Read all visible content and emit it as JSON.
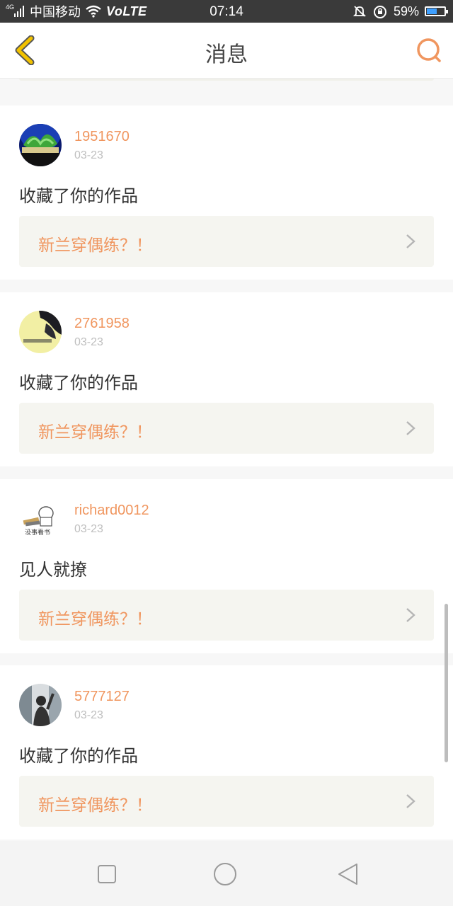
{
  "status_bar": {
    "network_type": "4G",
    "carrier": "中国移动",
    "volte": "VoLTE",
    "time": "07:14",
    "battery_percent": "59%",
    "battery_level": 0.59,
    "icons": [
      "signal-icon",
      "wifi-icon",
      "bell-muted-icon",
      "alarm-icon",
      "battery-icon"
    ]
  },
  "header": {
    "title": "消息",
    "back_icon": "chevron-left-icon",
    "search_icon": "search-icon"
  },
  "colors": {
    "accent": "#f0965f",
    "back_arrow": "#f2c200",
    "status_bar_bg": "#3a3a3a",
    "card_bg": "#f5f5f0"
  },
  "messages": [
    {
      "username": "1951670",
      "date": "03-23",
      "action": "收藏了你的作品",
      "work_title": "新兰穿偶练？！"
    },
    {
      "username": "2761958",
      "date": "03-23",
      "action": "收藏了你的作品",
      "work_title": "新兰穿偶练？！"
    },
    {
      "username": "richard0012",
      "date": "03-23",
      "action": "见人就撩",
      "work_title": "新兰穿偶练？！",
      "avatar_text": "没事看书"
    },
    {
      "username": "5777127",
      "date": "03-23",
      "action": "收藏了你的作品",
      "work_title": "新兰穿偶练？！"
    }
  ],
  "navbar": {
    "items": [
      "recent-apps-icon",
      "home-icon",
      "back-icon"
    ]
  }
}
